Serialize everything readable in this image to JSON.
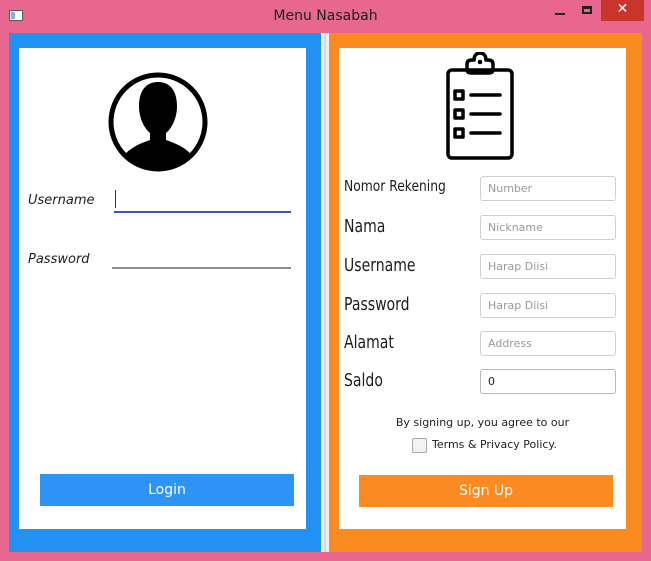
{
  "window": {
    "title": "Menu Nasabah",
    "close_glyph": "✕"
  },
  "login": {
    "username_label": "Username",
    "password_label": "Password",
    "username_value": "",
    "password_value": "",
    "login_label": "Login",
    "avatar_icon": "user-silhouette-icon"
  },
  "signup": {
    "clipboard_icon": "clipboard-checklist-icon",
    "fields": [
      {
        "label": "Nomor Rekening",
        "placeholder": "Number",
        "value": ""
      },
      {
        "label": "Nama",
        "placeholder": "Nickname",
        "value": ""
      },
      {
        "label": "Username",
        "placeholder": "Harap Diisi",
        "value": ""
      },
      {
        "label": "Password",
        "placeholder": "Harap Diisi",
        "value": ""
      },
      {
        "label": "Alamat",
        "placeholder": "Address",
        "value": ""
      },
      {
        "label": "Saldo",
        "placeholder": "",
        "value": "0"
      }
    ],
    "agree_text": "By signing up, you agree to our",
    "terms_label": "Terms & Privacy Policy.",
    "terms_checked": false,
    "signup_label": "Sign Up"
  },
  "colors": {
    "window_frame": "#e8678f",
    "login_panel": "#2191f2",
    "signup_panel": "#fb8a20",
    "close_button": "#c7352b"
  }
}
